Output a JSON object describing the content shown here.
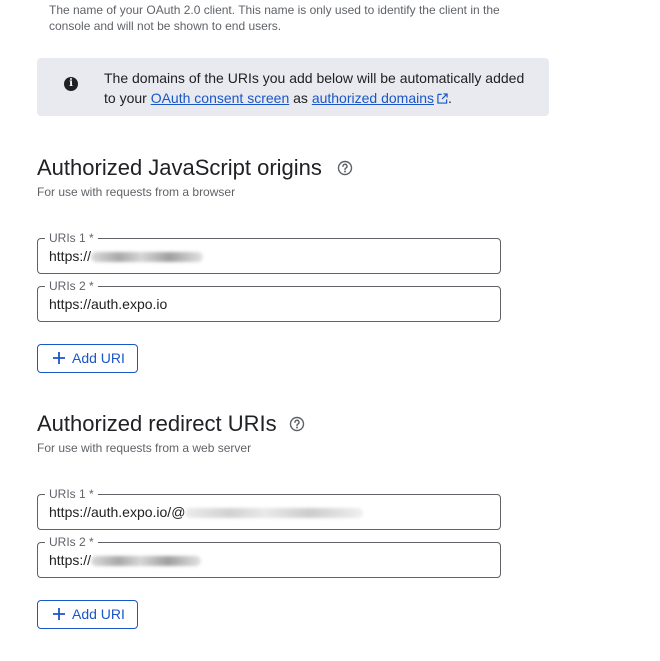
{
  "client_name_helper": "The name of your OAuth 2.0 client. This name is only used to identify the client in the console and will not be shown to end users.",
  "info": {
    "text_before": "The domains of the URIs you add below will be automatically added to your ",
    "consent_link": "OAuth consent screen",
    "text_mid": " as ",
    "domains_link": "authorized domains",
    "text_after": "."
  },
  "js_origins": {
    "title": "Authorized JavaScript origins",
    "subtitle": "For use with requests from a browser",
    "uris": [
      {
        "label": "URIs 1 *",
        "value": "https://"
      },
      {
        "label": "URIs 2 *",
        "value": "https://auth.expo.io"
      }
    ],
    "add_label": "Add URI"
  },
  "redirect_uris": {
    "title": "Authorized redirect URIs",
    "subtitle": "For use with requests from a web server",
    "uris": [
      {
        "label": "URIs 1 *",
        "value": "https://auth.expo.io/@"
      },
      {
        "label": "URIs 2 *",
        "value": "https://"
      }
    ],
    "add_label": "Add URI"
  },
  "colors": {
    "accent": "#1a56c8",
    "banner_bg": "#e8eaf0",
    "border": "#5f6368"
  }
}
